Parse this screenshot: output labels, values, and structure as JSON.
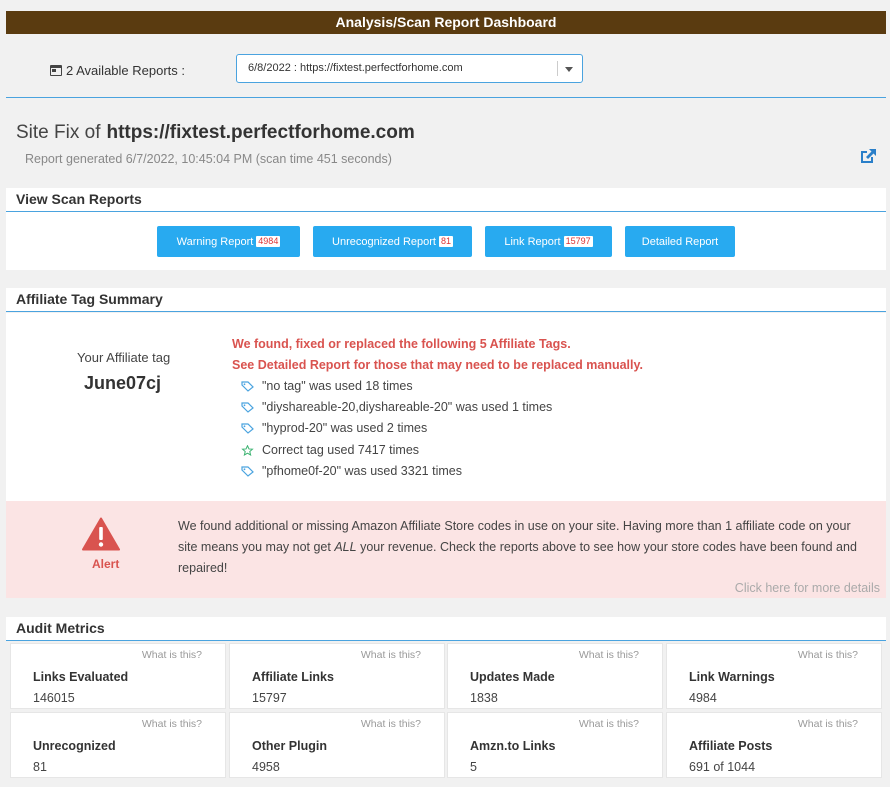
{
  "header": {
    "title": "Analysis/Scan Report Dashboard"
  },
  "reports": {
    "available_label": "2 Available Reports :",
    "selected": "6/8/2022 : https://fixtest.perfectforhome.com"
  },
  "site": {
    "prefix": "Site Fix of",
    "url": "https://fixtest.perfectforhome.com",
    "generated": "Report generated 6/7/2022, 10:45:04 PM (scan time 451 seconds)"
  },
  "scan_reports": {
    "heading": "View Scan Reports",
    "buttons": [
      {
        "label": "Warning Report",
        "count": "4984"
      },
      {
        "label": "Unrecognized Report",
        "count": "81"
      },
      {
        "label": "Link Report",
        "count": "15797"
      },
      {
        "label": "Detailed Report",
        "count": ""
      }
    ]
  },
  "affiliate": {
    "heading": "Affiliate Tag Summary",
    "your_tag_label": "Your Affiliate tag",
    "your_tag": "June07cj",
    "found_line": "We found, fixed or replaced the following 5 Affiliate Tags.",
    "see_line": "See Detailed Report for those that may need to be replaced manually.",
    "tags": [
      {
        "text": "\"no tag\" was used 18 times",
        "icon": "tag-icon"
      },
      {
        "text": "\"diyshareable-20,diyshareable-20\" was used 1 times",
        "icon": "tag-icon"
      },
      {
        "text": "\"hyprod-20\" was used 2 times",
        "icon": "tag-icon"
      },
      {
        "text": "Correct tag used 7417 times",
        "icon": "star-icon"
      },
      {
        "text": "\"pfhome0f-20\" was used 3321 times",
        "icon": "tag-icon"
      }
    ]
  },
  "alert": {
    "word": "Alert",
    "text_before": "We found additional or missing Amazon Affiliate Store codes in use on your site. Having more than 1 affiliate code on your site means you may not get ",
    "text_em": "ALL",
    "text_after": " your revenue. Check the reports above to see how your store codes have been found and repaired!",
    "more": "Click here for more details"
  },
  "metrics": {
    "heading": "Audit Metrics",
    "what_label": "What is this?",
    "items": [
      {
        "label": "Links Evaluated",
        "value": "146015"
      },
      {
        "label": "Affiliate Links",
        "value": "15797"
      },
      {
        "label": "Updates Made",
        "value": "1838"
      },
      {
        "label": "Link Warnings",
        "value": "4984"
      },
      {
        "label": "Unrecognized",
        "value": "81"
      },
      {
        "label": "Other Plugin",
        "value": "4958"
      },
      {
        "label": "Amzn.to Links",
        "value": "5"
      },
      {
        "label": "Affiliate Posts",
        "value": "691 of 1044"
      }
    ]
  },
  "colors": {
    "title_bg": "#5a3b10",
    "accent": "#28aaf0",
    "alert_red": "#d9534f",
    "alert_bg": "#fbe4e4",
    "tag_icon": "#4aa3df",
    "star_icon": "#3cb371"
  }
}
